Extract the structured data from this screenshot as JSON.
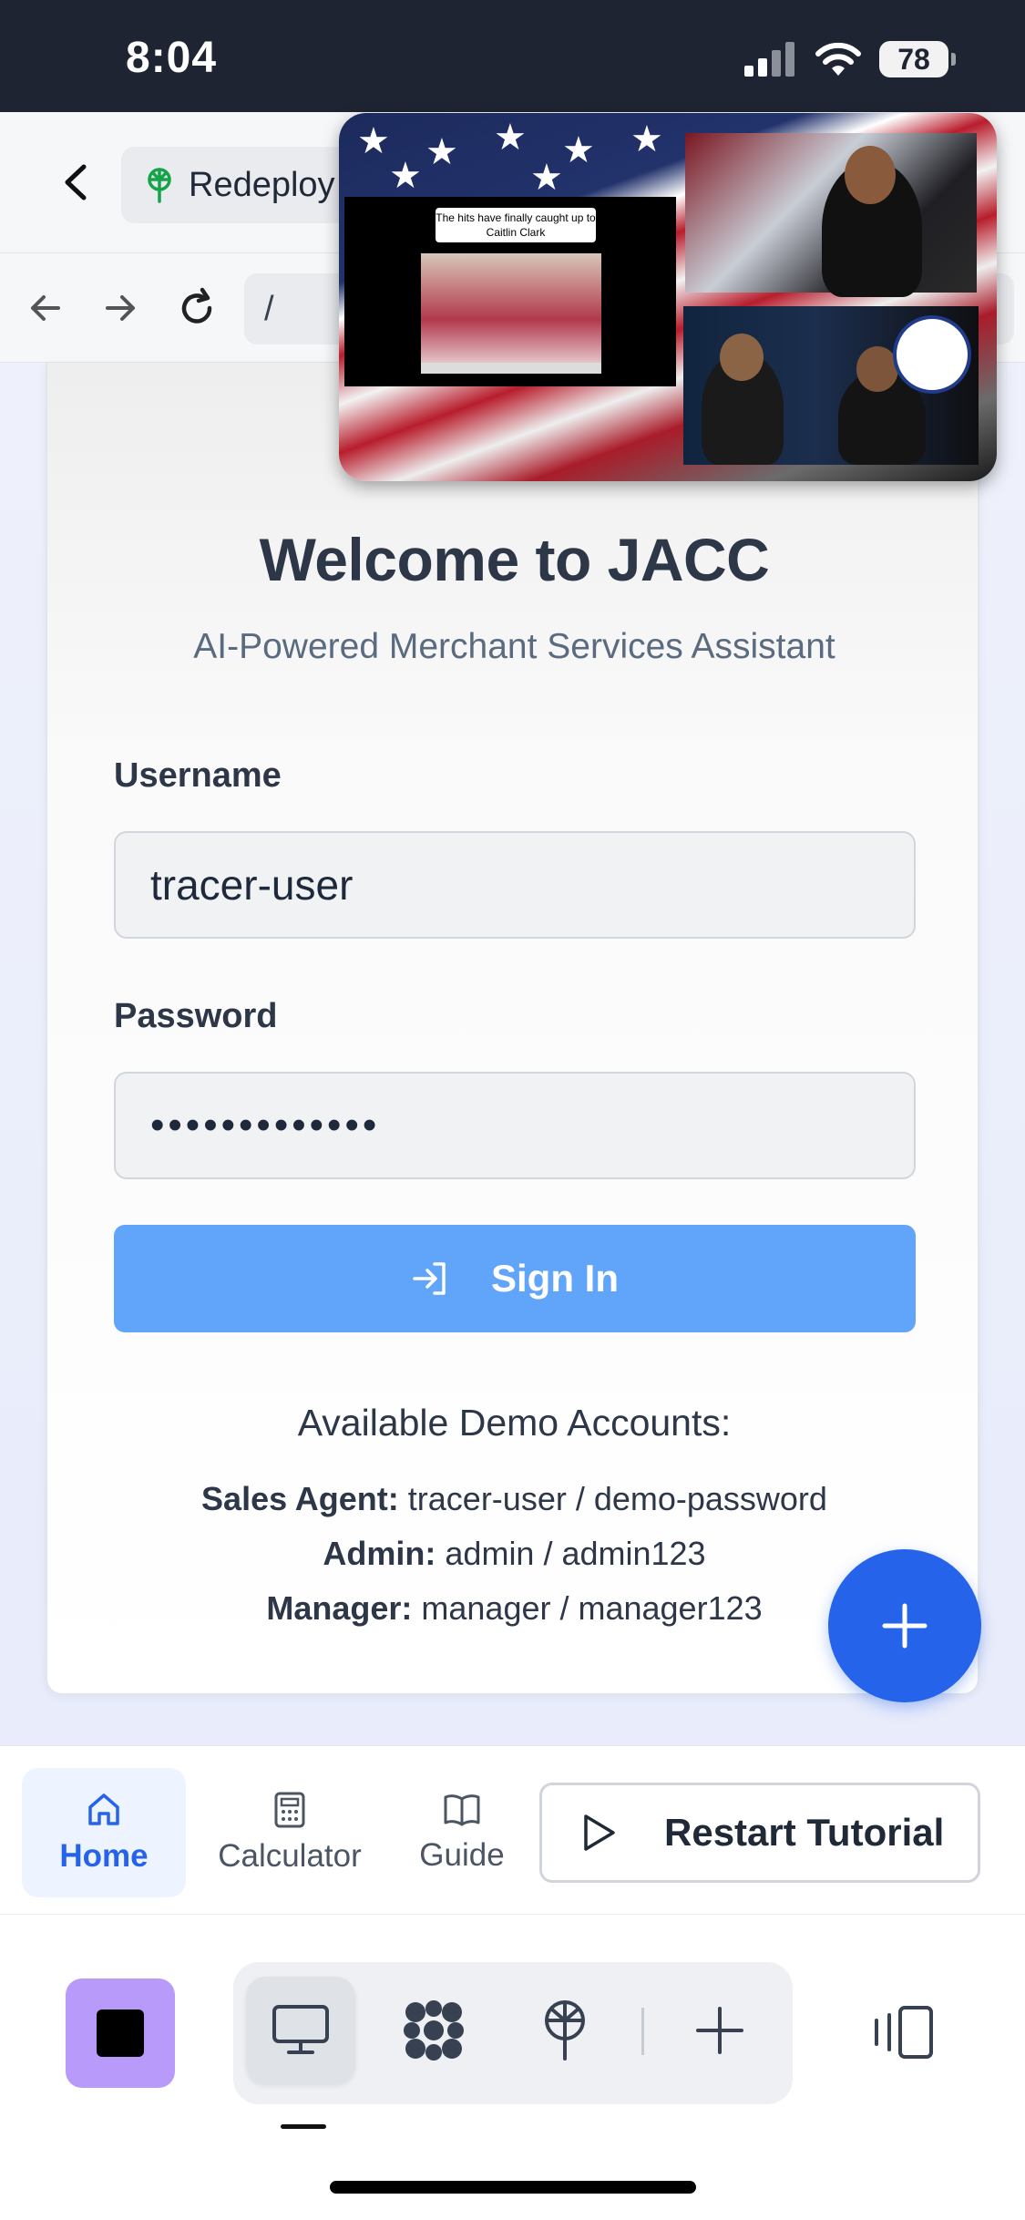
{
  "status_bar": {
    "time": "8:04",
    "battery": "78"
  },
  "top_bar": {
    "redeploy_label": "Redeploy"
  },
  "url_bar": {
    "url": "/"
  },
  "login": {
    "title": "Welcome to JACC",
    "subtitle": "AI-Powered Merchant Services Assistant",
    "username_label": "Username",
    "username_value": "tracer-user",
    "password_label": "Password",
    "password_masked": "•••••••••••••",
    "signin_label": "Sign In",
    "demo_title": "Available Demo Accounts:",
    "demo_accounts": [
      {
        "role": "Sales Agent:",
        "creds": "tracer-user / demo-password"
      },
      {
        "role": "Admin:",
        "creds": "admin / admin123"
      },
      {
        "role": "Manager:",
        "creds": "manager / manager123"
      }
    ]
  },
  "pip_video": {
    "caption": "The hits have finally caught up to Caitlin Clark"
  },
  "app_nav": {
    "tabs": [
      {
        "label": "Home",
        "icon": "home-icon",
        "active": true
      },
      {
        "label": "Calculator",
        "icon": "calculator-icon",
        "active": false
      },
      {
        "label": "Guide",
        "icon": "book-icon",
        "active": false
      }
    ],
    "restart_label": "Restart Tutorial"
  },
  "colors": {
    "accent": "#2563eb",
    "signin_button": "#60a5fa",
    "stop_button": "#b79af9",
    "status_bar": "#1f2433"
  }
}
